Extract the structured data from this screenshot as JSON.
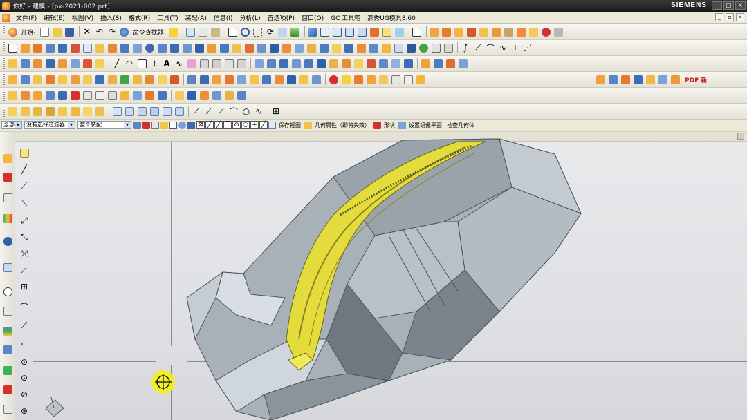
{
  "window": {
    "title": "你好 - 建模 - [px-2021-002.prt]",
    "brand": "SIEMENS",
    "controls": [
      "_",
      "□",
      "×"
    ]
  },
  "menubar": {
    "items": [
      "文件(F)",
      "编辑(E)",
      "视图(V)",
      "插入(S)",
      "格式(R)",
      "工具(T)",
      "装配(A)",
      "信息(I)",
      "分析(L)",
      "首选项(P)",
      "窗口(O)",
      "GC 工具箱",
      "燕秀UG模具8.60"
    ]
  },
  "toolbar_row1": {
    "start_label": "开始·",
    "command_finder_label": "命令查找器"
  },
  "toolbar_row5": {
    "pdf_label": "PDF 新"
  },
  "selection_bar": {
    "filter_scope": "全部",
    "type_filter": "没有选择过滤器",
    "assembly_scope": "整个装配",
    "save_view_label": "保存视图",
    "geom_property_label": "几何属性（即将失效）",
    "shape_label": "形状",
    "wcs_label": "设置镜像平面",
    "check_geom_label": "检查几何体"
  },
  "colors": {
    "titlebar": "#222222",
    "menubar": "#ece9d8",
    "viewport_bg": "#e2e4e7",
    "part_highlight": "#e8e040",
    "mold_block": "#8a9299"
  }
}
